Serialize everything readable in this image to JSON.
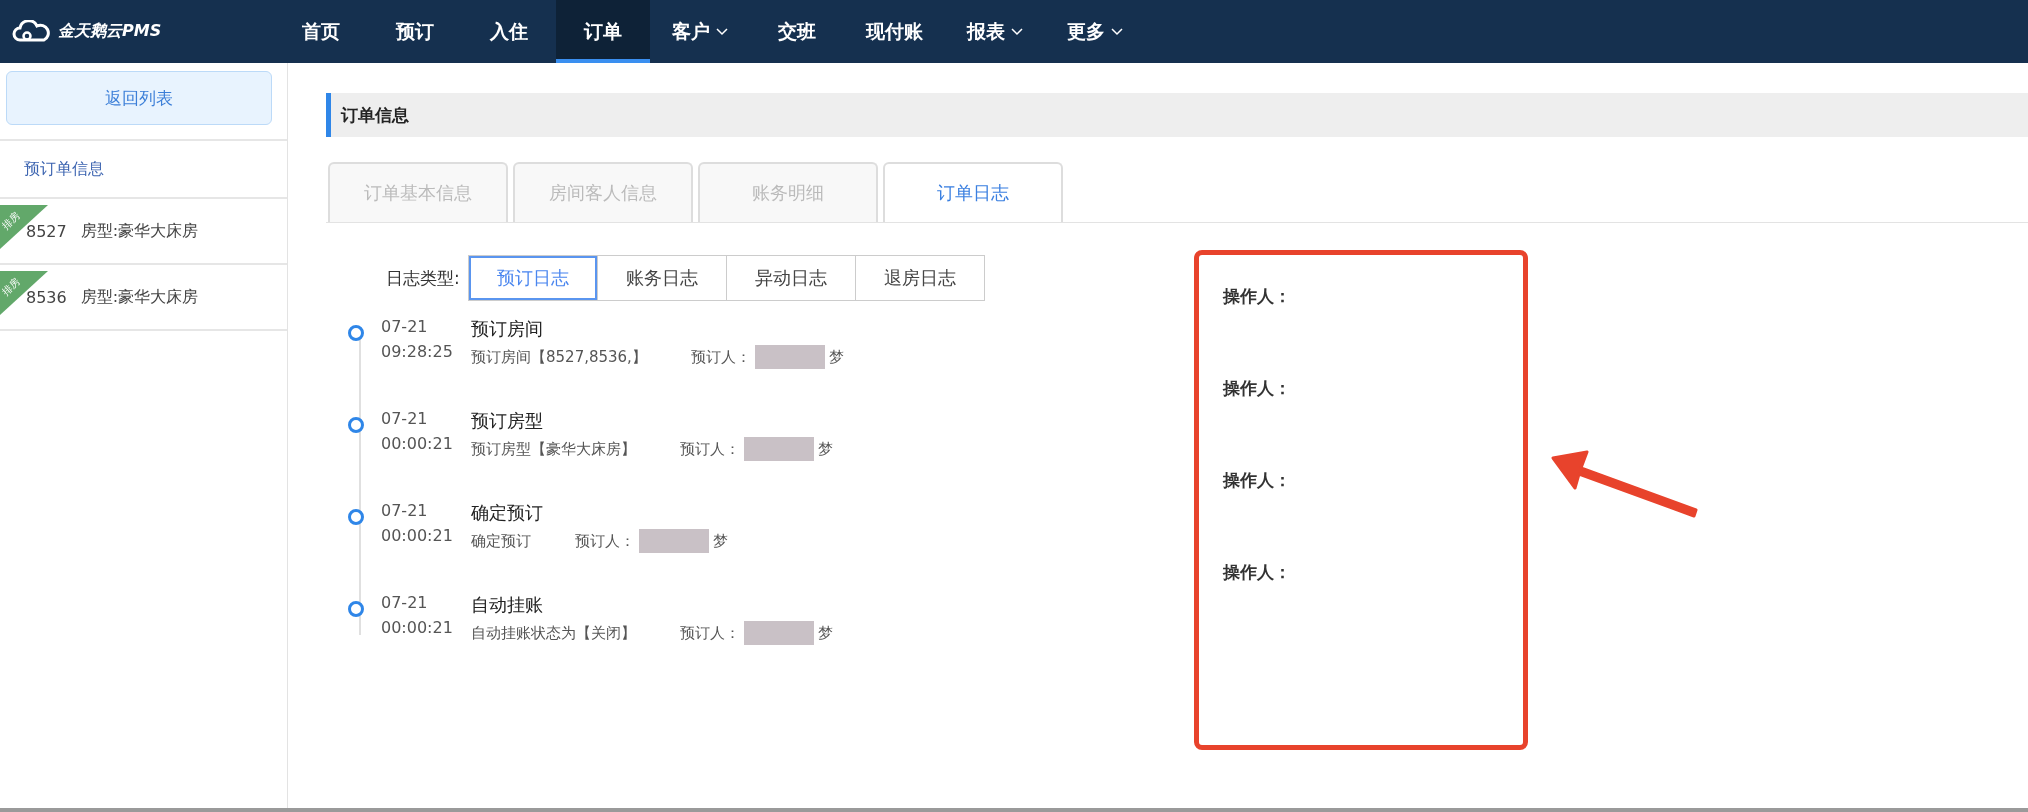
{
  "logo": {
    "text": "金天鹅云PMS"
  },
  "nav": [
    {
      "label": "首页",
      "selected": false,
      "dropdown": false
    },
    {
      "label": "预订",
      "selected": false,
      "dropdown": false
    },
    {
      "label": "入住",
      "selected": false,
      "dropdown": false
    },
    {
      "label": "订单",
      "selected": true,
      "dropdown": false
    },
    {
      "label": "客户",
      "selected": false,
      "dropdown": true
    },
    {
      "label": "交班",
      "selected": false,
      "dropdown": false
    },
    {
      "label": "现付账",
      "selected": false,
      "dropdown": false
    },
    {
      "label": "报表",
      "selected": false,
      "dropdown": true
    },
    {
      "label": "更多",
      "selected": false,
      "dropdown": true
    }
  ],
  "sidebar": {
    "back_button": "返回列表",
    "section": "预订单信息",
    "rooms": [
      {
        "badge": "排房",
        "room": "8527",
        "type": "房型:豪华大床房"
      },
      {
        "badge": "排房",
        "room": "8536",
        "type": "房型:豪华大床房"
      }
    ]
  },
  "section_title": "订单信息",
  "tabs": [
    {
      "label": "订单基本信息",
      "selected": false
    },
    {
      "label": "房间客人信息",
      "selected": false
    },
    {
      "label": "账务明细",
      "selected": false
    },
    {
      "label": "订单日志",
      "selected": true
    }
  ],
  "log_type": {
    "label": "日志类型:",
    "options": [
      {
        "label": "预订日志",
        "selected": true
      },
      {
        "label": "账务日志",
        "selected": false
      },
      {
        "label": "异动日志",
        "selected": false
      },
      {
        "label": "退房日志",
        "selected": false
      }
    ]
  },
  "logs": [
    {
      "date": "07-21",
      "time": "09:28:25",
      "title": "预订房间",
      "detail": "预订房间【8527,8536,】",
      "booker_label": "预订人：",
      "booker_visible": "梦",
      "operator_label": "操作人："
    },
    {
      "date": "07-21",
      "time": "00:00:21",
      "title": "预订房型",
      "detail": "预订房型【豪华大床房】",
      "booker_label": "预订人：",
      "booker_visible": "梦",
      "operator_label": "操作人："
    },
    {
      "date": "07-21",
      "time": "00:00:21",
      "title": "确定预订",
      "detail": "确定预订",
      "booker_label": "预订人：",
      "booker_visible": "梦",
      "operator_label": "操作人："
    },
    {
      "date": "07-21",
      "time": "00:00:21",
      "title": "自动挂账",
      "detail": "自动挂账状态为【关闭】",
      "booker_label": "预订人：",
      "booker_visible": "梦",
      "operator_label": "操作人："
    }
  ]
}
